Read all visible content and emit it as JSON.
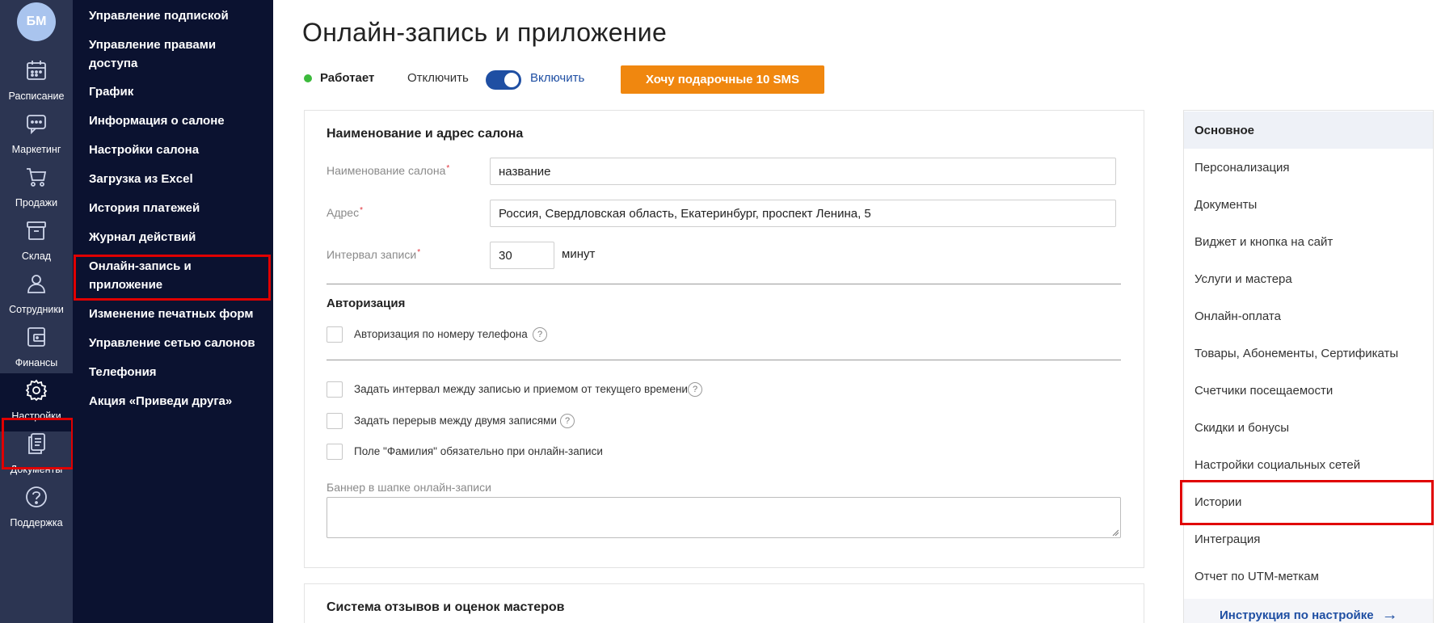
{
  "user": {
    "initials": "БМ"
  },
  "rail": [
    {
      "label": "Расписание",
      "icon": "calendar-icon"
    },
    {
      "label": "Маркетинг",
      "icon": "chat-icon"
    },
    {
      "label": "Продажи",
      "icon": "cart-icon"
    },
    {
      "label": "Склад",
      "icon": "box-icon"
    },
    {
      "label": "Сотрудники",
      "icon": "person-icon"
    },
    {
      "label": "Финансы",
      "icon": "wallet-icon"
    },
    {
      "label": "Настройки",
      "icon": "gear-icon"
    },
    {
      "label": "Документы",
      "icon": "documents-icon"
    },
    {
      "label": "Поддержка",
      "icon": "help-icon"
    }
  ],
  "submenu": [
    "Управление подпиской",
    "Управление правами доступа",
    "График",
    "Информация о салоне",
    "Настройки салона",
    "Загрузка из Excel",
    "История платежей",
    "Журнал действий",
    "Онлайн-запись и приложение",
    "Изменение печатных форм",
    "Управление сетью салонов",
    "Телефония",
    "Акция «Приведи друга»"
  ],
  "header": {
    "title": "Онлайн-запись и приложение",
    "status": "Работает",
    "status_color": "#3cba3c",
    "off_label": "Отключить",
    "on_label": "Включить",
    "toggle_on": true,
    "sms_button": "Хочу подарочные 10 SMS"
  },
  "form": {
    "section_title": "Наименование и адрес салона",
    "name_label": "Наименование салона",
    "name_value": "название",
    "address_label": "Адрес",
    "address_value": "Россия, Свердловская область, Екатеринбург, проспект Ленина, 5",
    "interval_label": "Интервал записи",
    "interval_value": "30",
    "interval_unit": "минут",
    "required_mark": "*",
    "auth_title": "Авторизация",
    "auth_phone": "Авторизация по номеру телефона",
    "opt_interval": "Задать интервал между записью и приемом от текущего времени",
    "opt_break": "Задать перерыв между двумя записями",
    "opt_surname": "Поле \"Фамилия\" обязательно при онлайн-записи",
    "banner_label": "Баннер в шапке онлайн-записи",
    "help_glyph": "?",
    "reviews_title": "Система отзывов и оценок мастеров"
  },
  "rightnav": {
    "items": [
      "Основное",
      "Персонализация",
      "Документы",
      "Виджет и кнопка на сайт",
      "Услуги и мастера",
      "Онлайн-оплата",
      "Товары, Абонементы, Сертификаты",
      "Счетчики посещаемости",
      "Скидки и бонусы",
      "Настройки социальных сетей",
      "Истории",
      "Интеграция",
      "Отчет по UTM-меткам"
    ],
    "footer": "Инструкция по настройке",
    "footer_arrow": "→"
  },
  "colors": {
    "accent": "#1f4fa3",
    "cta": "#f0870f",
    "rail_bg": "#2c3552",
    "submenu_bg": "#0b1230",
    "highlight": "#e00000"
  }
}
